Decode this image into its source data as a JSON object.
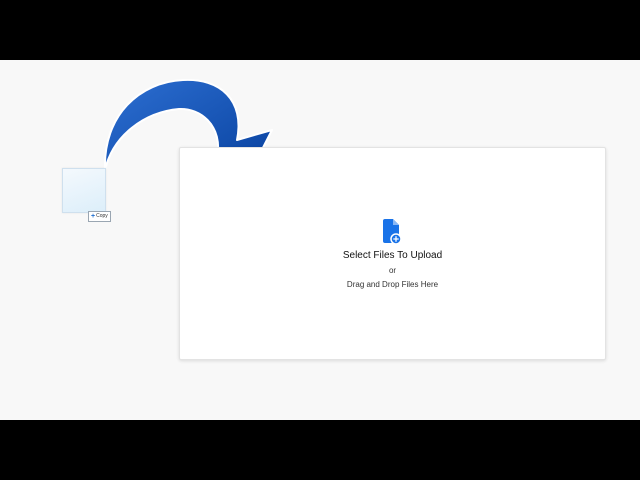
{
  "dropzone": {
    "title": "Select Files To Upload",
    "or_text": "or",
    "drag_text": "Drag and Drop Files Here",
    "icon": "file-add-icon",
    "accent_color": "#1a73e8"
  },
  "drag_preview": {
    "badge_label": "Copy",
    "badge_icon": "plus-icon"
  },
  "annotation": {
    "icon": "curved-arrow-icon",
    "color": "#0a4fb0"
  }
}
